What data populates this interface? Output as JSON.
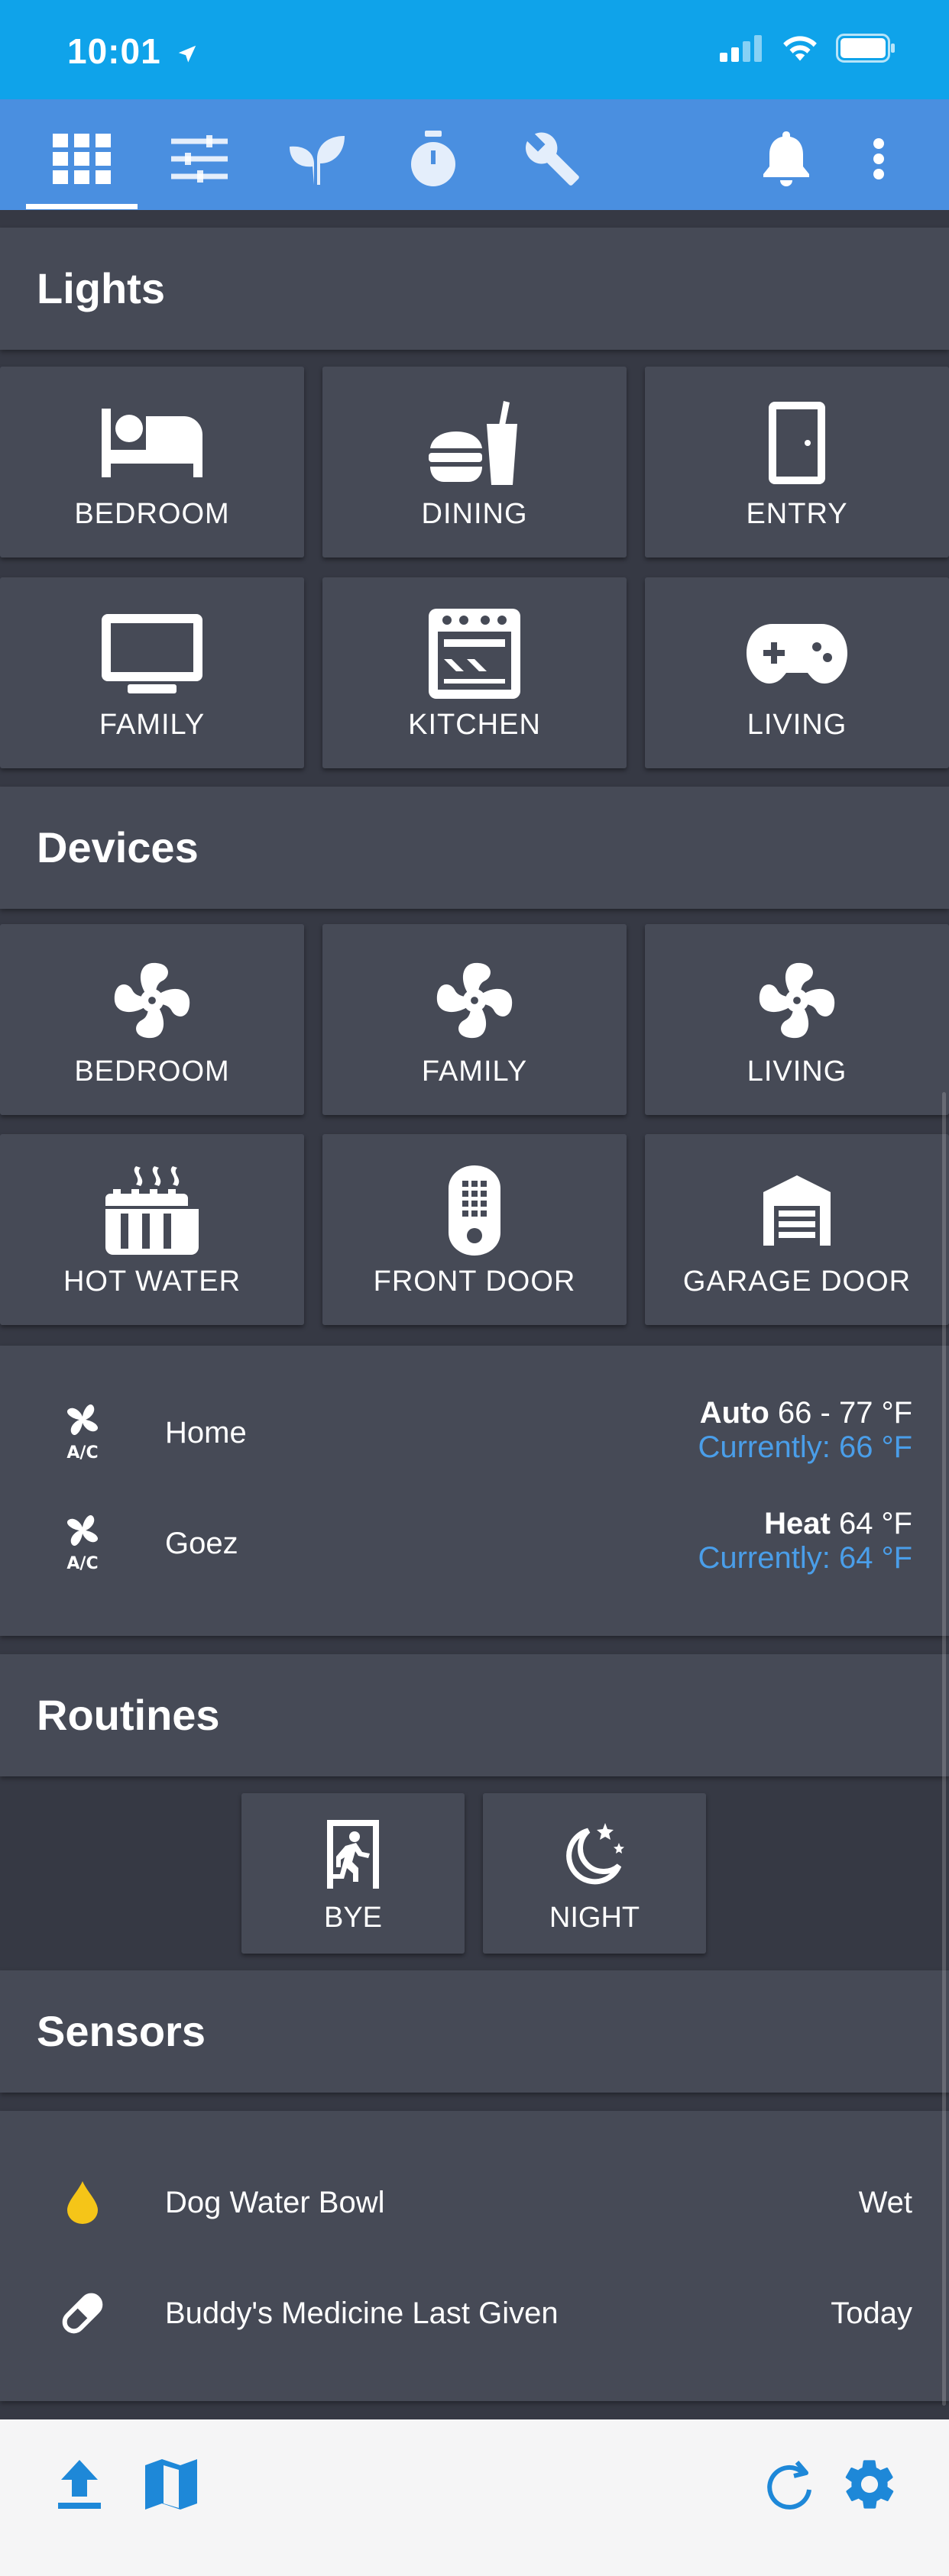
{
  "status_bar": {
    "time": "10:01"
  },
  "toolbar": {
    "icons": [
      "grid-icon",
      "sliders-icon",
      "sprout-icon",
      "stopwatch-icon",
      "wrench-icon",
      "bell-icon",
      "more-vertical-icon"
    ]
  },
  "lights": {
    "title": "Lights",
    "tiles": [
      {
        "label": "BEDROOM",
        "icon": "bed-icon"
      },
      {
        "label": "DINING",
        "icon": "food-drink-icon"
      },
      {
        "label": "ENTRY",
        "icon": "door-icon"
      },
      {
        "label": "FAMILY",
        "icon": "tv-icon"
      },
      {
        "label": "KITCHEN",
        "icon": "stove-icon"
      },
      {
        "label": "LIVING",
        "icon": "gamepad-icon"
      }
    ]
  },
  "devices": {
    "title": "Devices",
    "tiles": [
      {
        "label": "BEDROOM",
        "icon": "fan-icon"
      },
      {
        "label": "FAMILY",
        "icon": "fan-icon"
      },
      {
        "label": "LIVING",
        "icon": "fan-icon"
      },
      {
        "label": "HOT WATER",
        "icon": "heater-icon"
      },
      {
        "label": "FRONT DOOR",
        "icon": "remote-icon"
      },
      {
        "label": "GARAGE DOOR",
        "icon": "garage-icon"
      }
    ]
  },
  "climate": [
    {
      "name": "Home",
      "mode": "Auto",
      "setpoint": "66 - 77 °F",
      "current": "Currently: 66 °F",
      "icon": "air-conditioner-icon"
    },
    {
      "name": "Goez",
      "mode": "Heat",
      "setpoint": "64 °F",
      "current": "Currently: 64 °F",
      "icon": "air-conditioner-icon"
    }
  ],
  "routines": {
    "title": "Routines",
    "tiles": [
      {
        "label": "BYE",
        "icon": "exit-run-icon"
      },
      {
        "label": "NIGHT",
        "icon": "moon-stars-icon"
      }
    ]
  },
  "sensors": {
    "title": "Sensors",
    "rows": [
      {
        "name": "Dog Water Bowl",
        "value": "Wet",
        "icon": "water-drop-icon",
        "icon_color": "#f5c518"
      },
      {
        "name": "Buddy's Medicine Last Given",
        "value": "Today",
        "icon": "pill-icon"
      }
    ]
  },
  "bottom_bar": {
    "icons": [
      "upload-icon",
      "map-icon",
      "refresh-icon",
      "settings-icon"
    ],
    "accent": "#1e88d8"
  },
  "colors": {
    "status_bar": "#0fa3ea",
    "toolbar": "#4a8fe0",
    "background": "#363944",
    "card": "#464a56",
    "current_temp": "#4a9ee9"
  }
}
